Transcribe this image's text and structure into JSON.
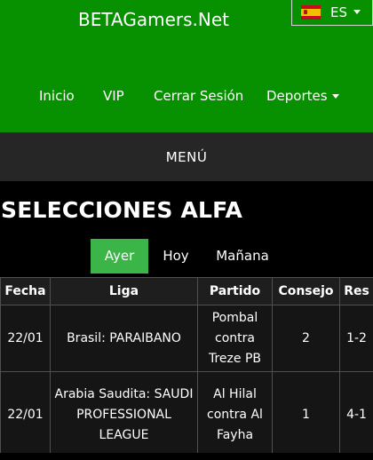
{
  "site": {
    "title": "BETAGamers.Net"
  },
  "language": {
    "code": "ES",
    "flag_icon": "spain-flag-icon"
  },
  "nav": {
    "items": [
      {
        "label": "Inicio"
      },
      {
        "label": "VIP"
      },
      {
        "label": "Cerrar Sesión"
      },
      {
        "label": "Deportes"
      }
    ]
  },
  "menu": {
    "label": "MENÚ"
  },
  "section": {
    "title": "SELECCIONES ALFA"
  },
  "tabs": [
    {
      "label": "Ayer",
      "active": true
    },
    {
      "label": "Hoy",
      "active": false
    },
    {
      "label": "Mañana",
      "active": false
    }
  ],
  "table": {
    "headers": [
      "Fecha",
      "Liga",
      "Partido",
      "Consejo",
      "Res"
    ],
    "rows": [
      {
        "fecha": "22/01",
        "liga": "Brasil: PARAIBANO",
        "partido": "Pombal contra Treze PB",
        "consejo": "2",
        "res": "1-2"
      },
      {
        "fecha": "22/01",
        "liga": "Arabia Saudita: SAUDI PROFESSIONAL LEAGUE",
        "partido": "Al Hilal contra Al Fayha",
        "consejo": "1",
        "res": "4-1"
      }
    ]
  },
  "colors": {
    "header_bg": "#079000",
    "menu_bg": "#262626",
    "active_tab": "#3bb548",
    "page_bg": "#000000"
  }
}
